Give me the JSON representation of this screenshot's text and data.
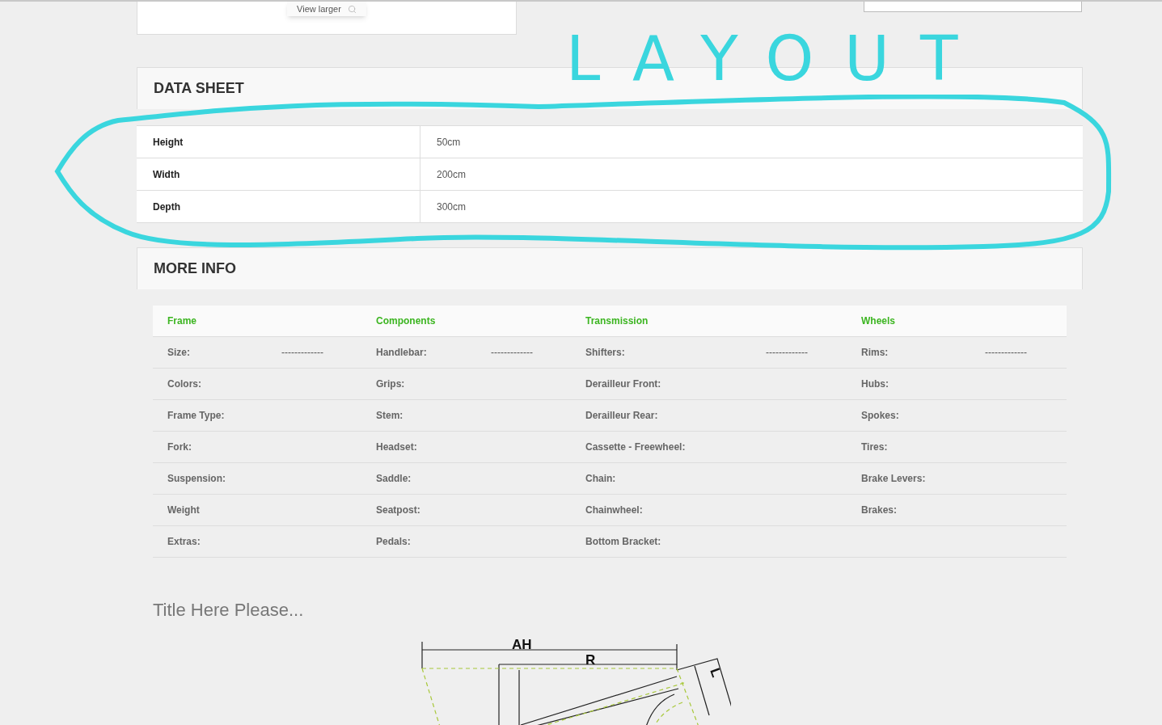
{
  "top_card": {
    "button": "View larger"
  },
  "annotation": {
    "text": "LAYOUT",
    "color": "#3ad6de"
  },
  "data_sheet": {
    "title": "DATA SHEET",
    "rows": [
      {
        "label": "Height",
        "value": "50cm"
      },
      {
        "label": "Width",
        "value": "200cm"
      },
      {
        "label": "Depth",
        "value": "300cm"
      }
    ]
  },
  "more_info": {
    "title": "MORE INFO",
    "columns": [
      {
        "heading": "Frame",
        "items": [
          {
            "label": "Size:",
            "value": "-------------"
          },
          {
            "label": "Colors:"
          },
          {
            "label": "Frame Type:"
          },
          {
            "label": "Fork:"
          },
          {
            "label": "Suspension:"
          },
          {
            "label": "Weight"
          },
          {
            "label": "Extras:"
          }
        ]
      },
      {
        "heading": "Components",
        "items": [
          {
            "label": "Handlebar:",
            "value": "-------------"
          },
          {
            "label": "Grips:"
          },
          {
            "label": "Stem:"
          },
          {
            "label": "Headset:"
          },
          {
            "label": "Saddle:"
          },
          {
            "label": "Seatpost:"
          },
          {
            "label": "Pedals:"
          }
        ]
      },
      {
        "heading": "Transmission",
        "items": [
          {
            "label": "Shifters:",
            "value": "-------------"
          },
          {
            "label": "Derailleur Front:"
          },
          {
            "label": "Derailleur Rear:"
          },
          {
            "label": "Cassette - Freewheel:"
          },
          {
            "label": "Chain:"
          },
          {
            "label": "Chainwheel:"
          },
          {
            "label": "Bottom Bracket:"
          }
        ]
      },
      {
        "heading": "Wheels",
        "items": [
          {
            "label": "Rims:",
            "value": "-------------"
          },
          {
            "label": "Hubs:"
          },
          {
            "label": "Spokes:"
          },
          {
            "label": "Tires:"
          },
          {
            "label": "Brake Levers:"
          },
          {
            "label": "Brakes:"
          }
        ]
      }
    ]
  },
  "geometry": {
    "title": "Title Here Please...",
    "labels": [
      "AH",
      "R",
      "L"
    ]
  }
}
